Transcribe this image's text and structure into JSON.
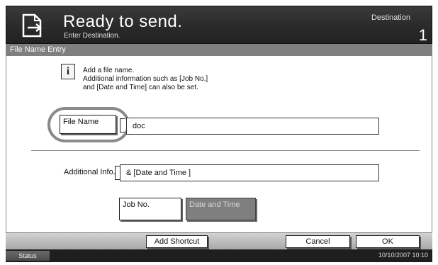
{
  "header": {
    "title": "Ready to send.",
    "subtitle": "Enter Destination.",
    "destination_label": "Destination",
    "destination_count": "1",
    "icon": "send-document-icon"
  },
  "panel": {
    "title": "File Name Entry"
  },
  "info": {
    "icon": "info-icon",
    "icon_glyph": "i",
    "line1": "Add a file name.",
    "line2": "Additional information such as [Job No.]",
    "line3": "and [Date and Time] can also be set."
  },
  "file_name": {
    "button_label": "File Name",
    "value": "doc"
  },
  "additional_info": {
    "label": "Additional Info.",
    "value": "& [Date and Time ]",
    "job_no_label": "Job No.",
    "date_time_label": "Date and Time",
    "date_time_selected": true
  },
  "footer": {
    "add_shortcut_label": "Add Shortcut",
    "cancel_label": "Cancel",
    "ok_label": "OK"
  },
  "status_bar": {
    "status_label": "Status",
    "datetime": "10/10/2007   10:10"
  },
  "colors": {
    "header_bg": "#2a2a2a",
    "panel_title_bg": "#7f7f7f",
    "selected_button_bg": "#7f7f7f",
    "highlight_ring": "#8a8a8a"
  }
}
